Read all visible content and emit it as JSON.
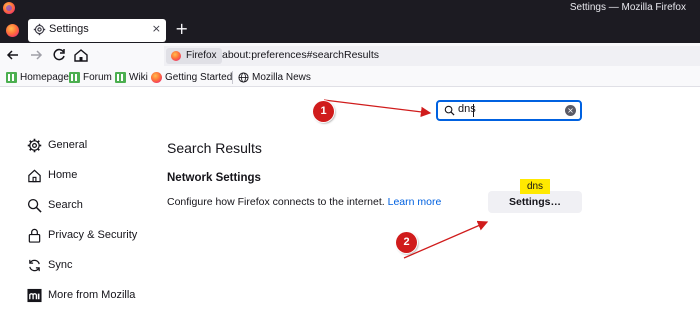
{
  "window": {
    "title": "Settings — Mozilla Firefox"
  },
  "tabs": [
    {
      "label": "Settings",
      "close": "×"
    }
  ],
  "new_tab": "+",
  "urlbar": {
    "identity": "Firefox",
    "url": "about:preferences#searchResults"
  },
  "bookmarks": [
    {
      "label": "Homepage",
      "icon": "green-bookmark-icon"
    },
    {
      "label": "Forum",
      "icon": "green-bookmark-icon"
    },
    {
      "label": "Wiki",
      "icon": "green-bookmark-icon"
    },
    {
      "label": "Getting Started",
      "icon": "firefox-icon"
    },
    {
      "label": "Mozilla News",
      "icon": "globe-icon"
    }
  ],
  "search": {
    "value": "dns",
    "clear": "×"
  },
  "sidebar": {
    "items": [
      {
        "label": "General",
        "icon": "gear-icon"
      },
      {
        "label": "Home",
        "icon": "home-icon"
      },
      {
        "label": "Search",
        "icon": "search-icon"
      },
      {
        "label": "Privacy & Security",
        "icon": "lock-icon"
      },
      {
        "label": "Sync",
        "icon": "sync-icon"
      },
      {
        "label": "More from Mozilla",
        "icon": "mozilla-icon"
      }
    ]
  },
  "main": {
    "title": "Search Results",
    "section_title": "Network Settings",
    "section_desc": "Configure how Firefox connects to the internet.",
    "learn_more": "Learn more",
    "settings_button": "Settings…",
    "highlight_tooltip": "dns"
  },
  "annotations": {
    "step1": "1",
    "step2": "2",
    "color": "#d01c1c"
  },
  "colors": {
    "accent": "#0061e0",
    "chrome_dark": "#1c1b22",
    "tooltip": "#ffe900"
  }
}
